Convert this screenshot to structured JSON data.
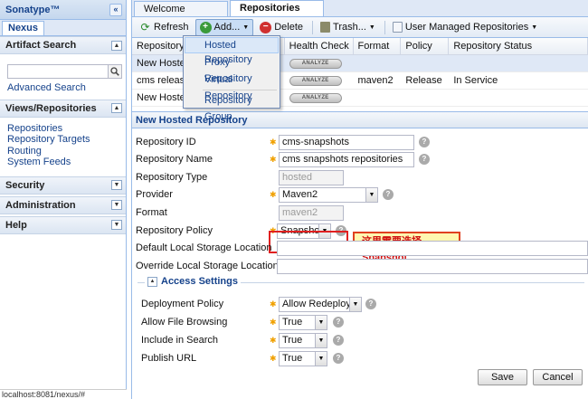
{
  "left": {
    "brand": "Sonatype™",
    "collapse_glyph": "«",
    "tab": "Nexus",
    "sections": {
      "artifact_search": {
        "title": "Artifact Search",
        "advanced_link": "Advanced Search"
      },
      "views": {
        "title": "Views/Repositories",
        "links": [
          "Repositories",
          "Repository Targets",
          "Routing",
          "System Feeds"
        ]
      },
      "security": {
        "title": "Security"
      },
      "administration": {
        "title": "Administration"
      },
      "help": {
        "title": "Help"
      }
    },
    "status_url": "localhost:8081/nexus/#"
  },
  "tabs": [
    "Welcome",
    "Repositories"
  ],
  "toolbar": {
    "refresh": "Refresh",
    "add": "Add...",
    "delete": "Delete",
    "trash": "Trash...",
    "user_managed": "User Managed Repositories"
  },
  "add_menu": [
    "Hosted Repository",
    "Proxy Repository",
    "Virtual Repository",
    "Repository Group"
  ],
  "grid": {
    "headers": [
      "Repository",
      "",
      "Health Check",
      "Format",
      "Policy",
      "Repository Status"
    ],
    "analyze_label": "ANALYZE",
    "rows": [
      {
        "name": "New Hosted R",
        "format": "",
        "policy": "",
        "status": ""
      },
      {
        "name": "cms release r",
        "format": "maven2",
        "policy": "Release",
        "status": "In Service"
      },
      {
        "name": "New Hosted R",
        "format": "",
        "policy": "",
        "status": ""
      }
    ]
  },
  "form": {
    "title": "New Hosted Repository",
    "labels": {
      "repo_id": "Repository ID",
      "repo_name": "Repository Name",
      "repo_type": "Repository Type",
      "provider": "Provider",
      "format": "Format",
      "policy": "Repository Policy",
      "default_storage": "Default Local Storage Location",
      "override_storage": "Override Local Storage Location"
    },
    "values": {
      "repo_id": "cms-snapshots",
      "repo_name": "cms snapshots repositories",
      "repo_type": "hosted",
      "provider": "Maven2",
      "format": "maven2",
      "policy": "Snapshot"
    },
    "annotation": "这里需要选择Snapshot",
    "access": {
      "legend": "Access Settings",
      "labels": {
        "deployment": "Deployment Policy",
        "browsing": "Allow File Browsing",
        "search": "Include in Search",
        "publish": "Publish URL"
      },
      "values": {
        "deployment": "Allow Redeploy",
        "browsing": "True",
        "search": "True",
        "publish": "True"
      }
    },
    "save": "Save",
    "cancel": "Cancel"
  },
  "colors": {
    "accent": "#15428b",
    "border": "#99bbe8",
    "annotation_red": "#e02020",
    "annotation_bg": "#fff7b0"
  },
  "icons": {
    "refresh": "refresh-icon",
    "add": "add-icon",
    "delete": "delete-icon",
    "trash": "trash-icon",
    "repos": "repository-icon",
    "help": "help-icon",
    "search": "search-icon"
  }
}
